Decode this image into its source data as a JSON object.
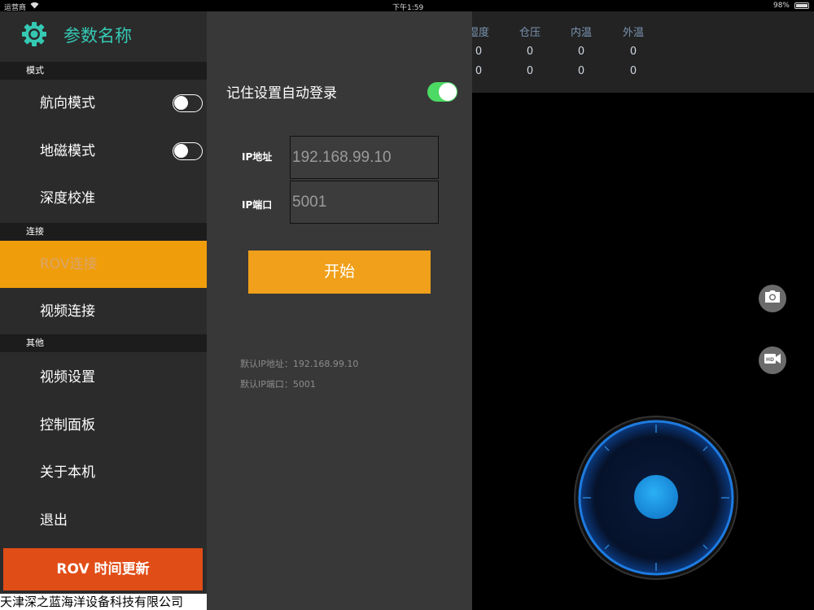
{
  "status_bar": {
    "carrier": "运营商",
    "time": "下午1:59",
    "battery": "98%"
  },
  "sidebar": {
    "title": "参数名称",
    "sections": {
      "mode": "模式",
      "connect": "连接",
      "other": "其他"
    },
    "items": {
      "heading_mode": "航向模式",
      "geomagnetic_mode": "地磁模式",
      "depth_calibration": "深度校准",
      "rov_connect": "ROV连接",
      "video_connect": "视频连接",
      "video_settings": "视频设置",
      "control_panel": "控制面板",
      "about": "关于本机",
      "exit": "退出"
    },
    "toggles": {
      "heading_mode": false,
      "geomagnetic_mode": false
    },
    "update_button": "ROV 时间更新",
    "company": "天津深之蓝海洋设备科技有限公司"
  },
  "login_panel": {
    "remember_label": "记住设置自动登录",
    "remember_on": true,
    "ip_label": "IP地址",
    "ip_value": "192.168.99.10",
    "port_label": "IP端口",
    "port_value": "5001",
    "start_button": "开始",
    "default_ip": "默认IP地址：192.168.99.10",
    "default_port": "默认IP端口：5001"
  },
  "data_header": {
    "columns": [
      {
        "label": "湿度",
        "row1": "0",
        "row2": "0"
      },
      {
        "label": "仓压",
        "row1": "0",
        "row2": "0"
      },
      {
        "label": "内温",
        "row1": "0",
        "row2": "0"
      },
      {
        "label": "外温",
        "row1": "0",
        "row2": "0"
      }
    ]
  },
  "colors": {
    "accent_orange": "#f09d0c",
    "update_red": "#e14d17",
    "title_teal": "#35c9b4",
    "toggle_green": "#4cd964",
    "joystick_blue": "#1a8fe0"
  },
  "icons": {
    "settings": "gear-icon",
    "photo": "camera-icon",
    "record": "hd-video-icon",
    "wifi": "wifi-icon",
    "battery": "battery-icon"
  }
}
